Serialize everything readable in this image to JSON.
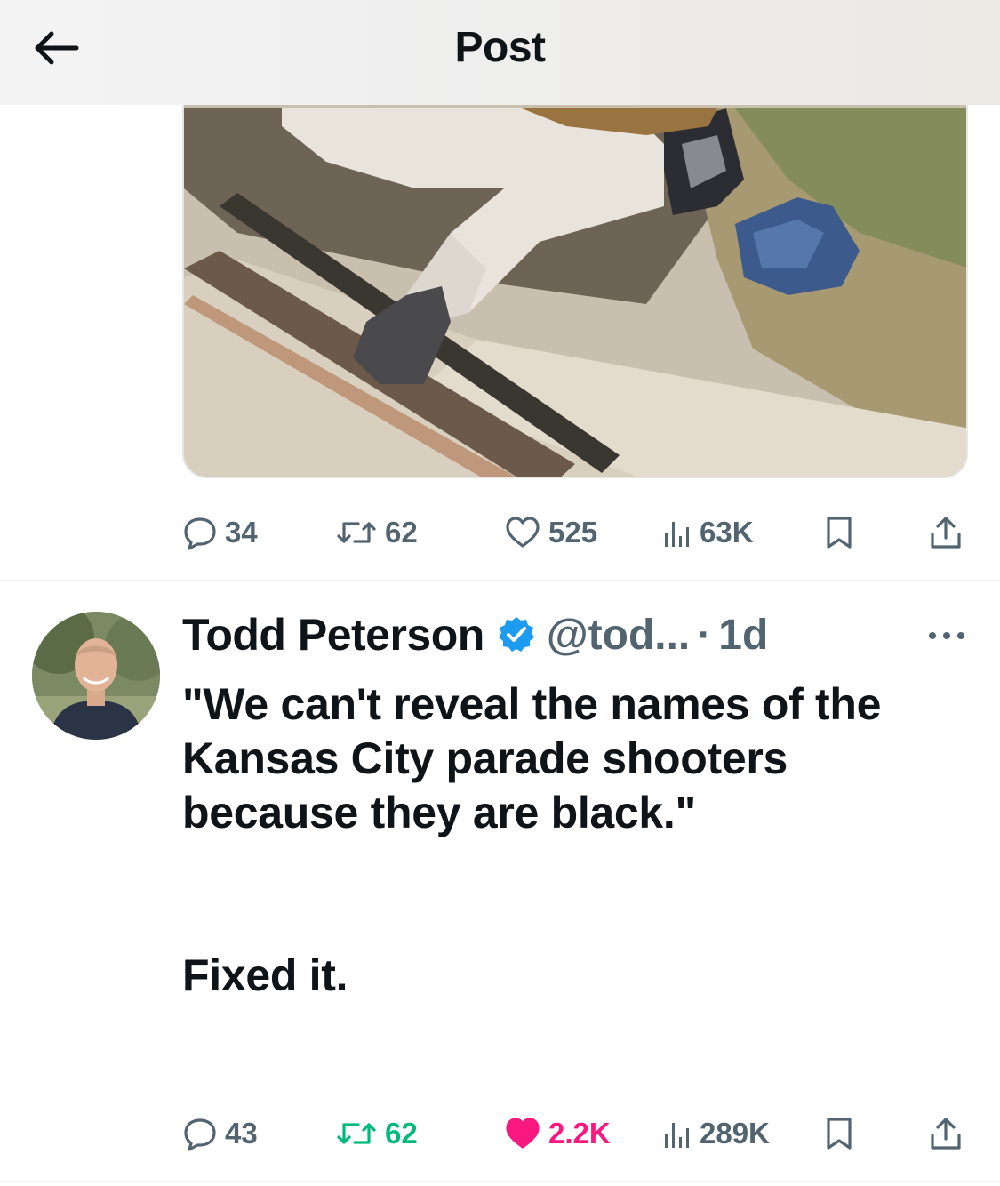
{
  "header": {
    "title": "Post",
    "back_icon": "arrow-left-icon"
  },
  "first_post": {
    "media_description_icon": "photo-media",
    "stats": {
      "replies": "34",
      "retweets": "62",
      "likes": "525",
      "views": "63K"
    }
  },
  "second_post": {
    "author_name": "Todd Peterson",
    "verified": true,
    "handle": "@tod...",
    "separator": "·",
    "time": "1d",
    "body_line1": "\"We can't reveal the names of the Kansas City parade shooters because they are black.\"",
    "body_line2": "Fixed it.",
    "stats": {
      "replies": "43",
      "retweets": "62",
      "likes": "2.2K",
      "views": "289K"
    }
  },
  "colors": {
    "text_primary": "#0f1419",
    "text_secondary": "#536471",
    "verified_blue": "#1d9bf0",
    "like_pink": "#f91880",
    "retweet_green": "#00ba7c",
    "divider": "#eff3f4"
  },
  "icons": [
    "arrow-left-icon",
    "reply-icon",
    "retweet-icon",
    "heart-icon",
    "views-icon",
    "bookmark-icon",
    "share-icon",
    "verified-badge-icon",
    "more-icon"
  ]
}
